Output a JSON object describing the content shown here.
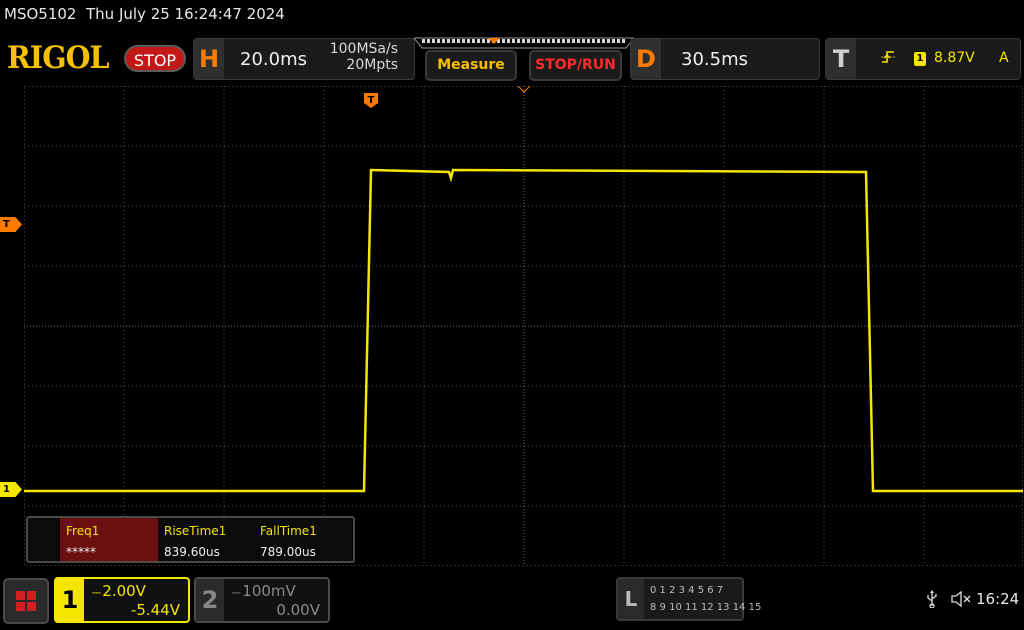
{
  "header": {
    "model": "MSO5102",
    "datetime": "Thu July 25 16:24:47 2024",
    "logo": "RIGOL",
    "run_state": "STOP"
  },
  "horizontal": {
    "letter": "H",
    "timebase": "20.0ms",
    "sample_rate": "100MSa/s",
    "memory_depth": "20Mpts"
  },
  "buttons": {
    "measure": "Measure",
    "stop_run": "STOP/RUN"
  },
  "delay": {
    "letter": "D",
    "value": "30.5ms"
  },
  "trigger": {
    "letter": "T",
    "edge_icon": "rising-edge-icon",
    "source": "1",
    "level": "8.87V",
    "mode": "A"
  },
  "markers": {
    "trigger_position": "T",
    "trigger_level": "T",
    "ch1": "1"
  },
  "measurements": [
    {
      "name": "Freq1",
      "value": "*****"
    },
    {
      "name": "RiseTime1",
      "value": "839.60us"
    },
    {
      "name": "FallTime1",
      "value": "789.00us"
    }
  ],
  "channels": [
    {
      "number": "1",
      "scale": "2.00V",
      "offset": "-5.44V",
      "active": true,
      "color": "#f5e600"
    },
    {
      "number": "2",
      "scale": "100mV",
      "offset": "0.00V",
      "active": false,
      "color": "#8a8a8a"
    }
  ],
  "logic_analyzer": {
    "letter": "L",
    "row1": "0 1 2 3  4 5 6 7",
    "row2": "8 9 10 11 12 13 14 15"
  },
  "status": {
    "clock": "16:24",
    "icons": [
      "usb-icon",
      "speaker-muted-icon"
    ]
  },
  "colors": {
    "trace": "#f5e600",
    "accent_orange": "#ff7a00",
    "stop_red": "#c21818",
    "logo_yellow": "#f5c000"
  }
}
